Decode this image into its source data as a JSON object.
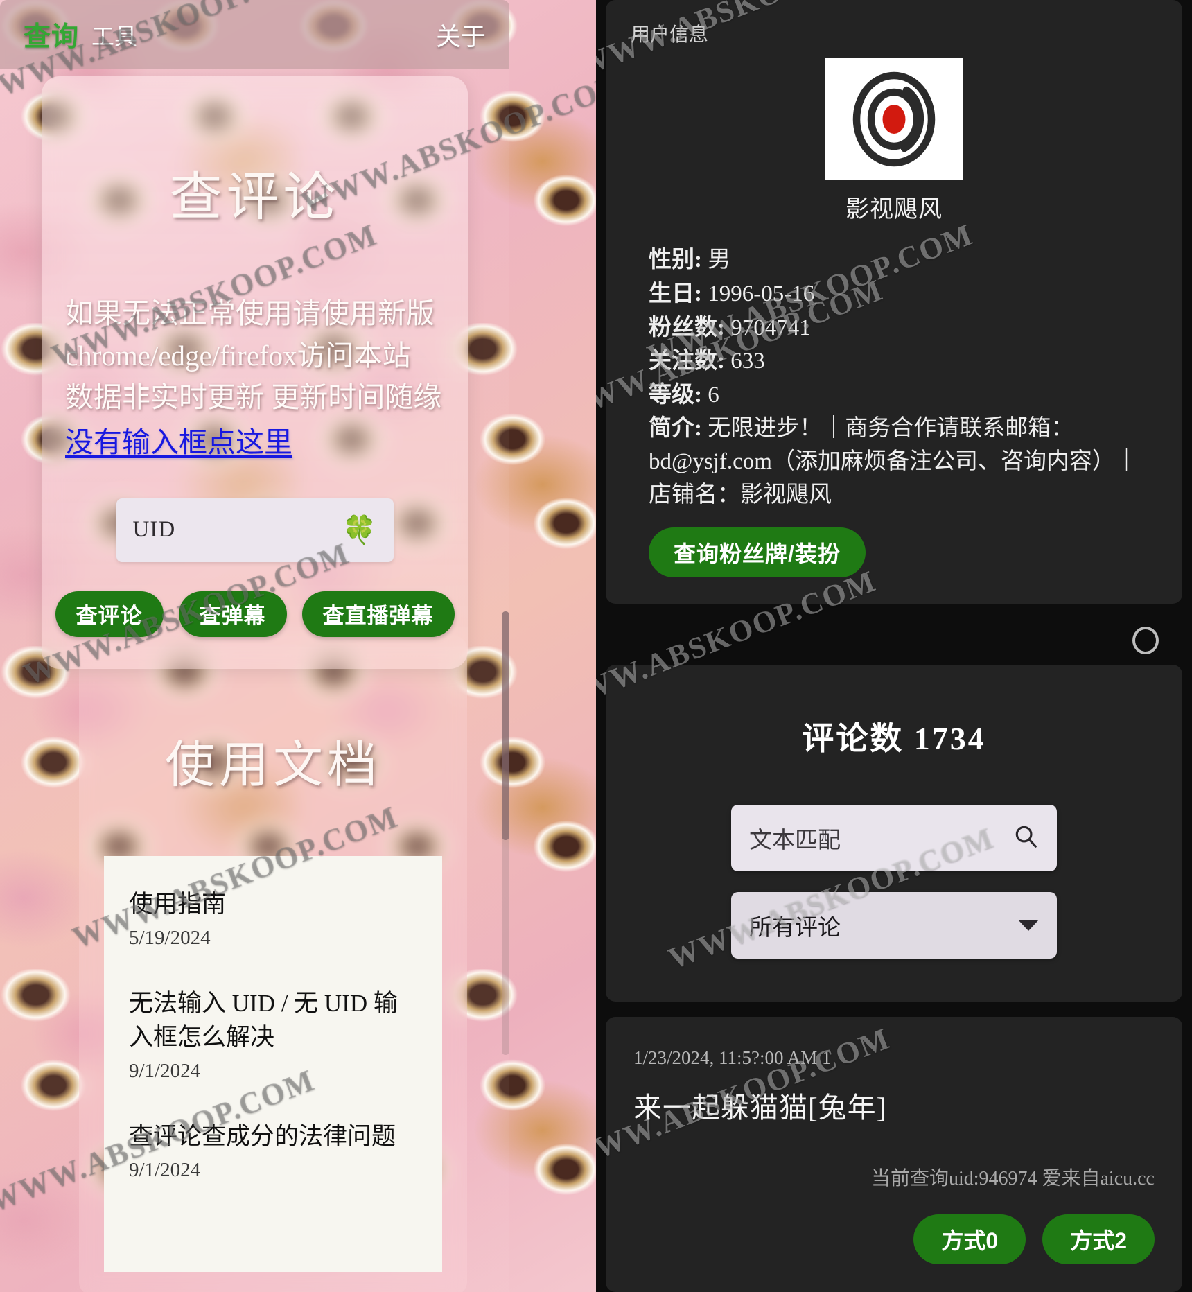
{
  "header": {
    "brand": "查询",
    "tool": "工具",
    "about": "关于"
  },
  "main_card": {
    "title": "查评论",
    "notice_line1": "如果无法正常使用请使用新版",
    "notice_line2": "chrome/edge/firefox访问本站",
    "notice_line3": "数据非实时更新 更新时间随缘",
    "notice_link": "没有输入框点这里",
    "uid_placeholder": "UID",
    "clover_icon": "🍀",
    "buttons": [
      {
        "label": "查评论"
      },
      {
        "label": "查弹幕"
      },
      {
        "label": "查直播弹幕"
      }
    ]
  },
  "docs_card": {
    "title": "使用文档",
    "items": [
      {
        "name": "使用指南",
        "date": "5/19/2024"
      },
      {
        "name": "无法输入 UID / 无 UID 输入框怎么解决",
        "date": "9/1/2024"
      },
      {
        "name": "查评论查成分的法律问题",
        "date": "9/1/2024"
      }
    ]
  },
  "user_info": {
    "section_label": "用户信息",
    "avatar_icon": "spiral-logo-avatar",
    "name": "影视飓风",
    "fields": [
      {
        "key": "性别:",
        "value": "男"
      },
      {
        "key": "生日:",
        "value": "1996-05-16"
      },
      {
        "key": "粉丝数:",
        "value": "9704741"
      },
      {
        "key": "关注数:",
        "value": "633"
      },
      {
        "key": "等级:",
        "value": "6"
      }
    ],
    "bio_key": "简介:",
    "bio_value": "无限进步！｜商务合作请联系邮箱：bd@ysjf.com（添加麻烦备注公司、咨询内容）｜店铺名：影视飓风",
    "fan_button": "查询粉丝牌/装扮"
  },
  "comments_panel": {
    "count_title": "评论数 1734",
    "search_placeholder": "文本匹配",
    "search_icon": "search-icon",
    "filter_value": "所有评论",
    "caret_icon": "chevron-down-icon"
  },
  "comment": {
    "timestamp": "1/23/2024, 11:5?:00 AM 1",
    "text": "来一起躲猫猫[兔年]",
    "footer": "当前查询uid:946974 爱来自aicu.cc",
    "mode_buttons": [
      {
        "label": "方式0"
      },
      {
        "label": "方式2"
      }
    ]
  },
  "watermark": {
    "text": "WWW.ABSKOOP.COM"
  },
  "colors": {
    "brand_green": "#34a734",
    "button_green": "#1f7a14",
    "link_blue": "#1818e0",
    "dark_card": "#232323",
    "page_dark": "#0d0d0d"
  }
}
